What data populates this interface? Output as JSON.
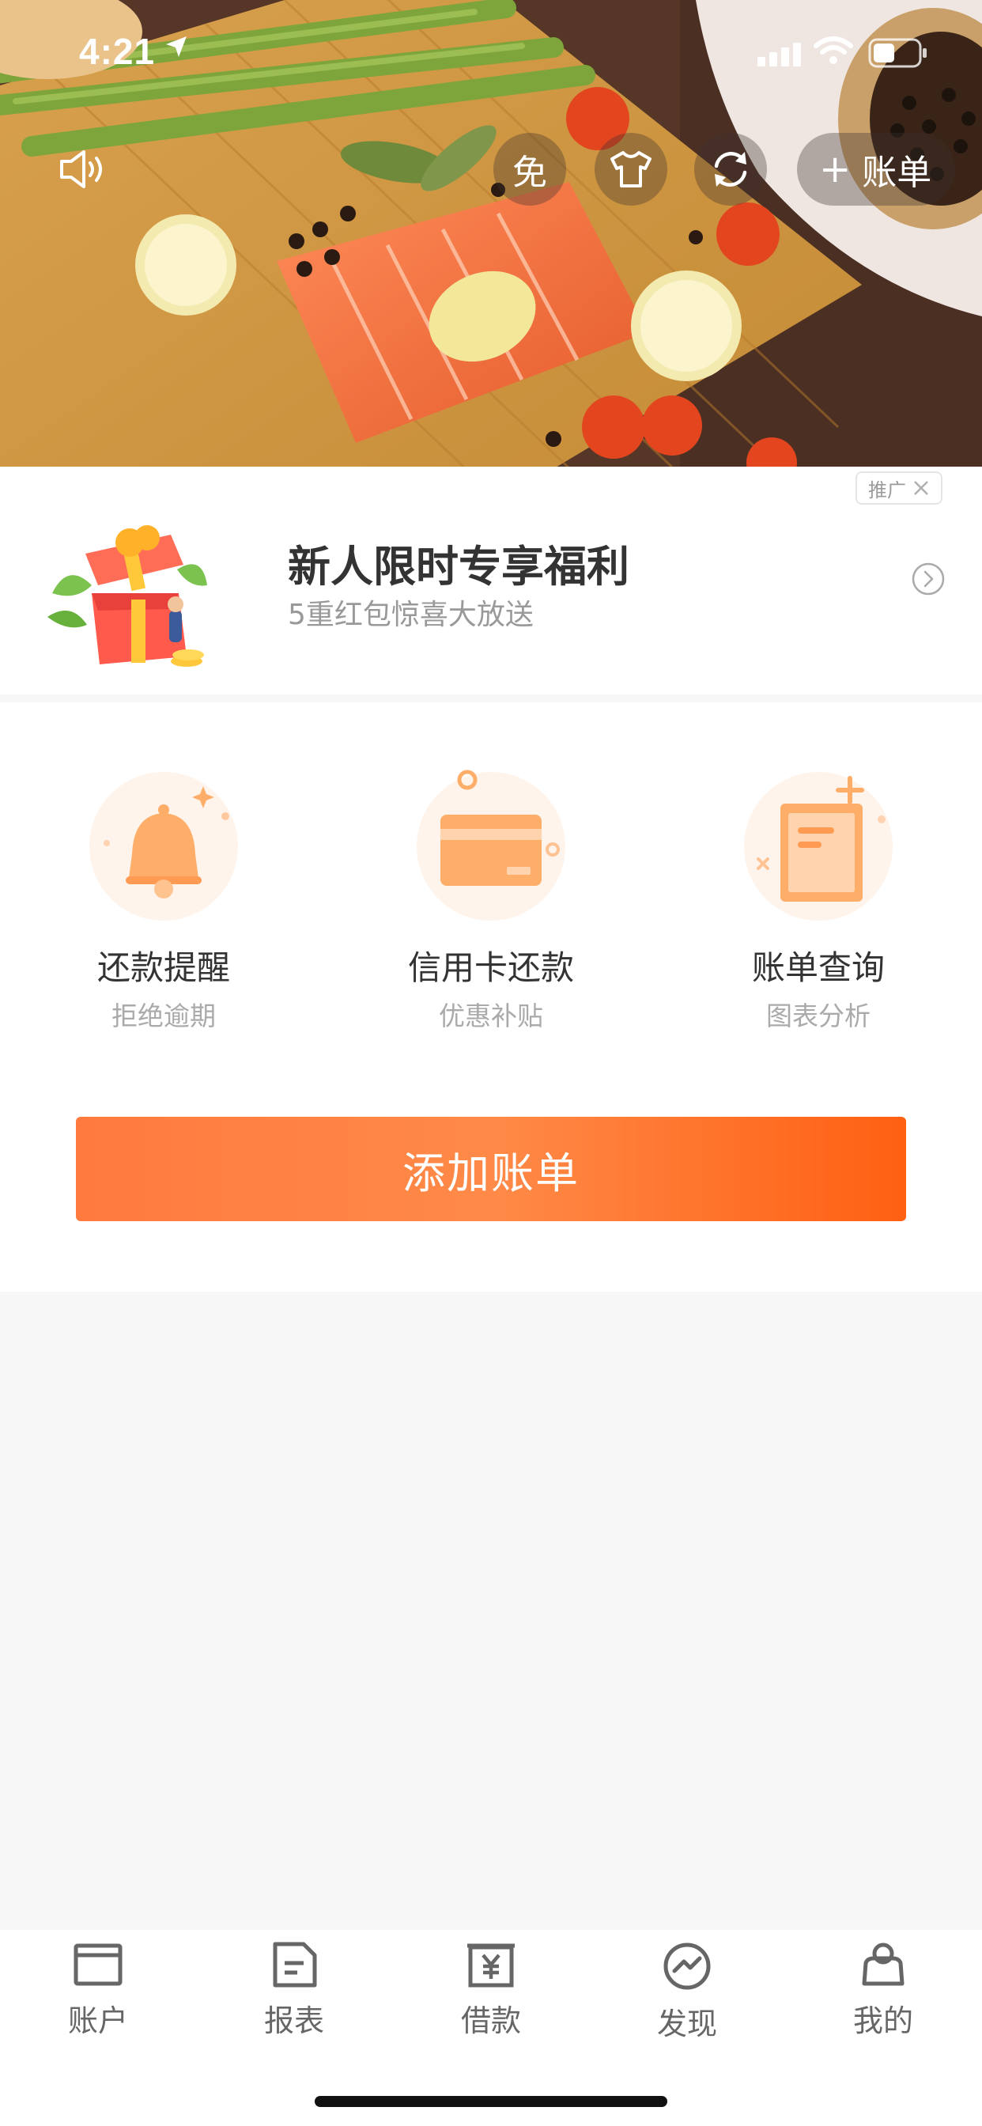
{
  "status_bar": {
    "time": "4:21"
  },
  "hero": {
    "buttons": {
      "sound_icon": "speaker-icon",
      "free_label": "免",
      "skin_icon": "tshirt-icon",
      "refresh_icon": "refresh-icon",
      "add_bill_label": "账单"
    }
  },
  "promo": {
    "tag": "推广",
    "title": "新人限时专享福利",
    "subtitle": "5重红包惊喜大放送"
  },
  "features": [
    {
      "title": "还款提醒",
      "subtitle": "拒绝逾期",
      "icon": "bell-icon"
    },
    {
      "title": "信用卡还款",
      "subtitle": "优惠补贴",
      "icon": "credit-card-icon"
    },
    {
      "title": "账单查询",
      "subtitle": "图表分析",
      "icon": "bill-document-icon"
    }
  ],
  "main_button": {
    "label": "添加账单"
  },
  "tabbar": {
    "items": [
      {
        "label": "账户",
        "icon": "wallet-icon"
      },
      {
        "label": "报表",
        "icon": "report-icon"
      },
      {
        "label": "借款",
        "icon": "yuan-icon"
      },
      {
        "label": "发现",
        "icon": "discover-icon"
      },
      {
        "label": "我的",
        "icon": "profile-bag-icon"
      }
    ]
  },
  "colors": {
    "accent": "#ff6a25",
    "accent_light": "#ffb27a",
    "text_primary": "#333333",
    "text_secondary": "#999999",
    "background": "#f7f7f7"
  }
}
